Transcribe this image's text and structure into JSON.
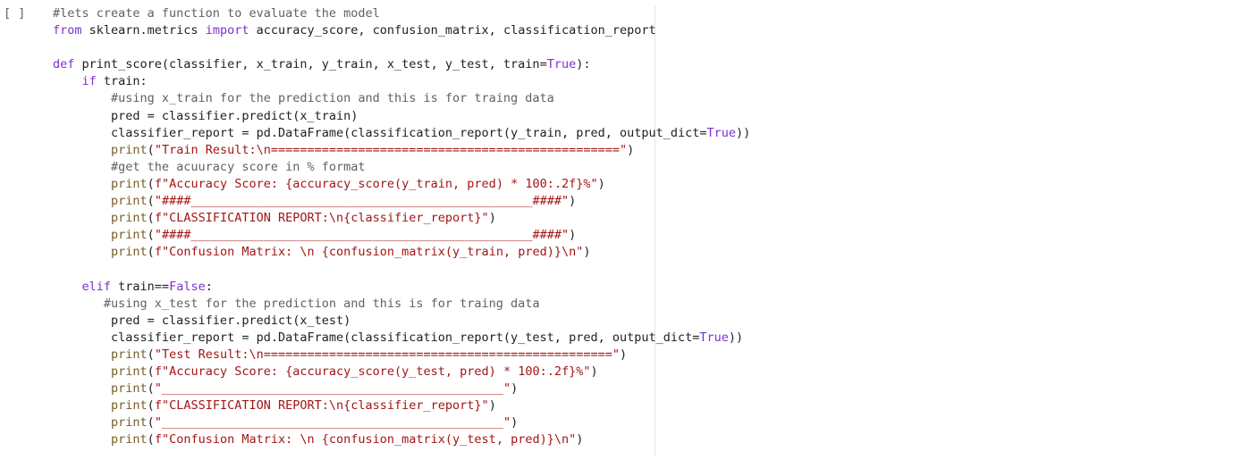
{
  "cell": {
    "prompt": "[ ]"
  },
  "code": {
    "lines": [
      "#lets create a function to evaluate the model",
      "from sklearn.metrics import accuracy_score, confusion_matrix, classification_report",
      "",
      "def print_score(classifier, x_train, y_train, x_test, y_test, train=True):",
      "    if train:",
      "        #using x_train for the prediction and this is for traing data",
      "        pred = classifier.predict(x_train)",
      "        classifier_report = pd.DataFrame(classification_report(y_train, pred, output_dict=True))",
      "        print(\"Train Result:\\n================================================\")",
      "        #get the acuuracy score in % format",
      "        print(f\"Accuracy Score: {accuracy_score(y_train, pred) * 100:.2f}%\")",
      "        print(\"####_______________________________________________####\")",
      "        print(f\"CLASSIFICATION REPORT:\\n{classifier_report}\")",
      "        print(\"####_______________________________________________####\")",
      "        print(f\"Confusion Matrix: \\n {confusion_matrix(y_train, pred)}\\n\")",
      "",
      "    elif train==False:",
      "       #using x_test for the prediction and this is for traing data",
      "        pred = classifier.predict(x_test)",
      "        classifier_report = pd.DataFrame(classification_report(y_test, pred, output_dict=True))",
      "        print(\"Test Result:\\n================================================\")",
      "        print(f\"Accuracy Score: {accuracy_score(y_test, pred) * 100:.2f}%\")",
      "        print(\"_______________________________________________\")",
      "        print(f\"CLASSIFICATION REPORT:\\n{classifier_report}\")",
      "        print(\"_______________________________________________\")",
      "        print(f\"Confusion Matrix: \\n {confusion_matrix(y_test, pred)}\\n\")"
    ]
  },
  "colors": {
    "keyword": "#7b30d0",
    "comment": "#616161",
    "string": "#a31515",
    "text": "#212121"
  }
}
